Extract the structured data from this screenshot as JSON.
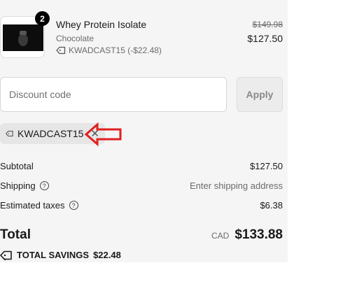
{
  "line_item": {
    "quantity": "2",
    "name": "Whey Protein Isolate",
    "variant": "Chocolate",
    "discount": "KWADCAST15 (-$22.48)",
    "original_price": "$149.98",
    "price": "$127.50",
    "image_icon": "protein-tub-image"
  },
  "discount_form": {
    "placeholder": "Discount code",
    "apply_label": "Apply"
  },
  "applied_code": {
    "code": "KWADCAST15",
    "remove_icon": "close-icon"
  },
  "annotation": {
    "color": "#e02020",
    "icon": "arrow-left-icon"
  },
  "summary": {
    "subtotal_label": "Subtotal",
    "subtotal_value": "$127.50",
    "shipping_label": "Shipping",
    "shipping_value": "Enter shipping address",
    "taxes_label": "Estimated taxes",
    "taxes_value": "$6.38",
    "help_icon_glyph": "?"
  },
  "total": {
    "label": "Total",
    "currency": "CAD",
    "value": "$133.88"
  },
  "savings": {
    "label": "TOTAL SAVINGS",
    "value": "$22.48"
  }
}
